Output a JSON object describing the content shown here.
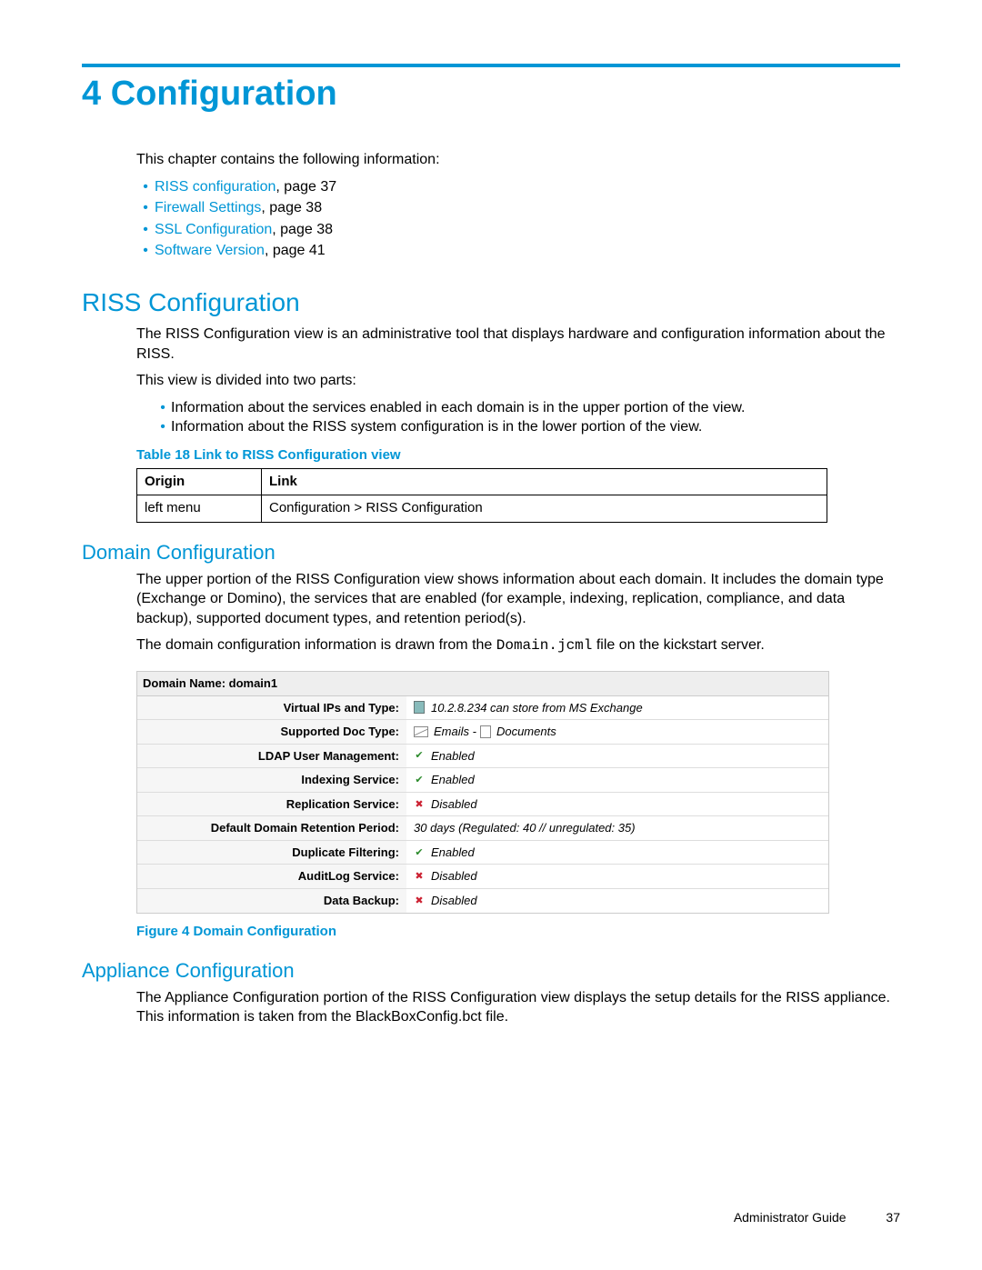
{
  "chapter": {
    "number": "4",
    "title": "Configuration"
  },
  "intro": "This chapter contains the following information:",
  "toc": [
    {
      "label": "RISS configuration",
      "page": ", page 37"
    },
    {
      "label": "Firewall Settings",
      "page": ", page 38"
    },
    {
      "label": "SSL Configuration",
      "page": ", page 38"
    },
    {
      "label": "Software Version",
      "page": ", page 41"
    }
  ],
  "riss": {
    "heading": "RISS Configuration",
    "p1": "The RISS Configuration view is an administrative tool that displays hardware and configuration information about the RISS.",
    "p2": "This view is divided into two parts:",
    "bullets": [
      "Information about the services enabled in each domain is in the upper portion of the view.",
      "Information about the RISS system configuration is in the lower portion of the view."
    ],
    "tableCaption": "Table 18 Link to RISS Configuration view",
    "tableHead": {
      "c1": "Origin",
      "c2": "Link"
    },
    "tableRow": {
      "c1": "left menu",
      "c2": "Configuration > RISS Configuration"
    }
  },
  "domain": {
    "heading": "Domain Configuration",
    "p1": "The upper portion of the RISS Configuration view shows information about each domain. It includes the domain type (Exchange or Domino), the services that are enabled (for example, indexing, replication, compliance, and data backup), supported document types, and retention period(s).",
    "p2a": "The domain configuration information is drawn from the ",
    "p2mono": "Domain.jcml",
    "p2b": " file on the kickstart server.",
    "figureCaption": "Figure 4 Domain Configuration",
    "shot": {
      "title": "Domain Name: domain1",
      "rows": [
        {
          "label": "Virtual IPs and Type:",
          "value": "10.2.8.234 can store from MS Exchange",
          "icon": "server"
        },
        {
          "label": "Supported Doc Type:",
          "value": "Emails -",
          "value2": "Documents",
          "icon": "emaildoc"
        },
        {
          "label": "LDAP User Management:",
          "value": "Enabled",
          "icon": "check"
        },
        {
          "label": "Indexing Service:",
          "value": "Enabled",
          "icon": "check"
        },
        {
          "label": "Replication Service:",
          "value": "Disabled",
          "icon": "cross"
        },
        {
          "label": "Default Domain Retention Period:",
          "value": "30 days (Regulated: 40 // unregulated: 35)",
          "icon": "none"
        },
        {
          "label": "Duplicate Filtering:",
          "value": "Enabled",
          "icon": "check"
        },
        {
          "label": "AuditLog Service:",
          "value": "Disabled",
          "icon": "cross"
        },
        {
          "label": "Data Backup:",
          "value": "Disabled",
          "icon": "cross"
        }
      ]
    }
  },
  "appliance": {
    "heading": "Appliance Configuration",
    "p1": "The Appliance Configuration portion of the RISS Configuration view displays the setup details for the RISS appliance. This information is taken from the BlackBoxConfig.bct file."
  },
  "footer": {
    "book": "Administrator Guide",
    "page": "37"
  }
}
